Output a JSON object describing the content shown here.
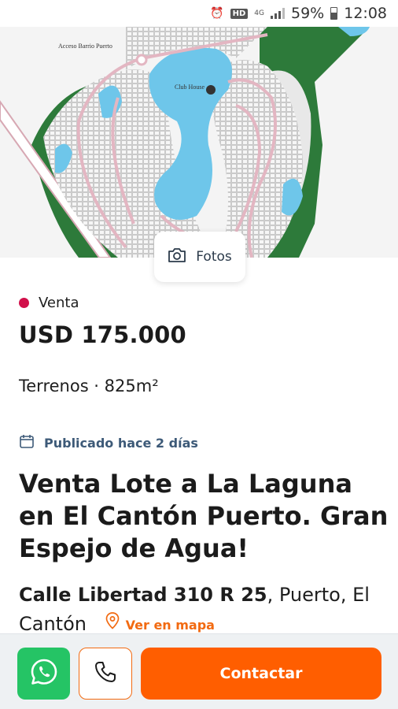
{
  "status_bar": {
    "network": "4G",
    "hd_badge": "HD",
    "battery": "59%",
    "time": "12:08"
  },
  "hero": {
    "map_labels": {
      "access": "Acceso Barrio Puerto",
      "club": "Club House"
    },
    "photos_label": "Fotos"
  },
  "listing": {
    "operation": "Venta",
    "price": "USD 175.000",
    "features": "Terrenos · 825m²",
    "published": "Publicado hace 2 días",
    "title": "Venta Lote a La Laguna en El Cantón Puerto. Gran Espejo de Agua!",
    "address_street": "Calle Libertad 310 R 25",
    "address_area": ", Puerto, El Cantón",
    "map_link": "Ver en mapa"
  },
  "actions": {
    "contact_label": "Contactar"
  },
  "colors": {
    "accent": "#ff5e00",
    "whatsapp": "#25c465",
    "operation_dot": "#d10f4a",
    "water": "#6ec6ea",
    "green": "#2d7a3a"
  }
}
